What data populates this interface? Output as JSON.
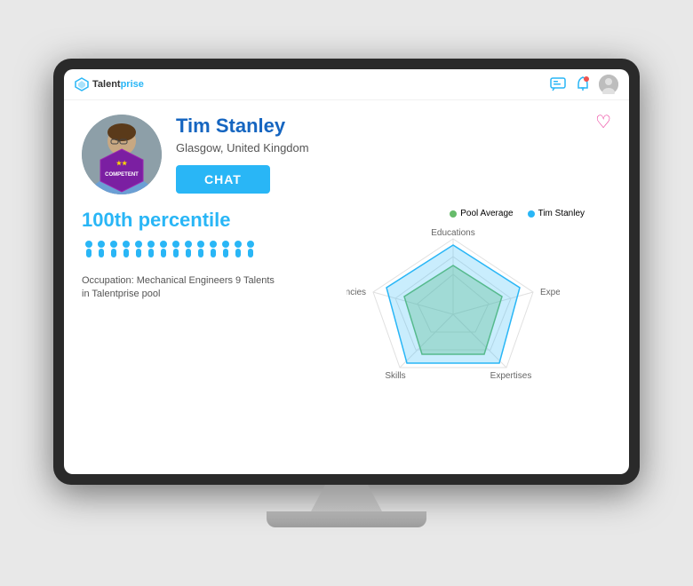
{
  "app": {
    "name": "Talentprise",
    "logo_text_1": "Talent",
    "logo_text_2": "prise"
  },
  "header": {
    "heart_icon": "♡",
    "chat_icon": "💬",
    "bell_icon": "🔔"
  },
  "profile": {
    "name": "Tim Stanley",
    "location": "Glasgow, United Kingdom",
    "chat_button": "CHAT",
    "badge_label": "COMPETENT",
    "badge_stars": "★★"
  },
  "stats": {
    "percentile": "100th percentile",
    "occupation_text": "Occupation: Mechanical Engineers 9 Talents\nin Talentprise pool",
    "people_count": 14
  },
  "chart": {
    "legend": [
      {
        "label": "Pool Average",
        "color": "#66bb6a"
      },
      {
        "label": "Tim Stanley",
        "color": "#29b6f6"
      }
    ],
    "labels": {
      "top": "Educations",
      "right": "Experiences",
      "bottom_right": "Expertises",
      "bottom_left": "Skills",
      "left": "Competencies"
    }
  }
}
